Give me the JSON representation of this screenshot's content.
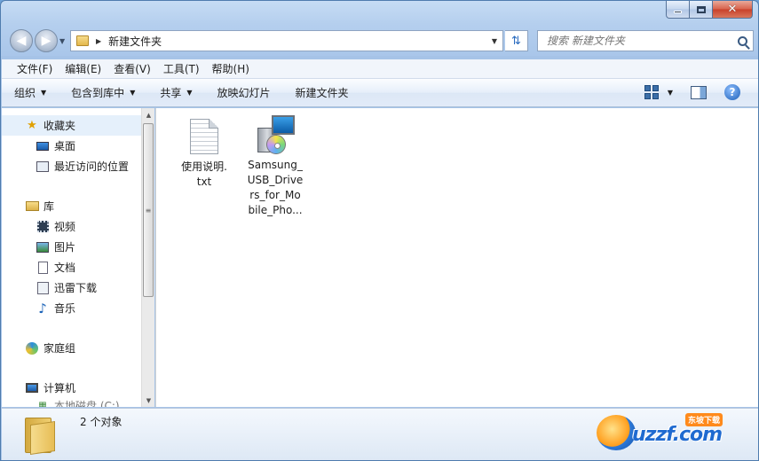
{
  "window": {
    "caption_close": "✕"
  },
  "address": {
    "path": "新建文件夹"
  },
  "search": {
    "placeholder": "搜索 新建文件夹"
  },
  "menubar": {
    "items": [
      "文件(F)",
      "编辑(E)",
      "查看(V)",
      "工具(T)",
      "帮助(H)"
    ]
  },
  "toolbar": {
    "organize": "组织",
    "include_in_library": "包含到库中",
    "share": "共享",
    "slideshow": "放映幻灯片",
    "new_folder": "新建文件夹",
    "help": "?"
  },
  "navpane": {
    "favorites": "收藏夹",
    "desktop": "桌面",
    "recent": "最近访问的位置",
    "libraries": "库",
    "videos": "视频",
    "pictures": "图片",
    "documents": "文档",
    "thunder": "迅雷下载",
    "music": "音乐",
    "homegroup": "家庭组",
    "computer": "计算机",
    "local_disk": "本地磁盘 (C:)"
  },
  "files": [
    {
      "name": "使用说明.txt",
      "line1": "使用说明.",
      "line2": "txt",
      "icon": "text-file-icon"
    },
    {
      "name": "Samsung_USB_Drivers_for_Mobile_Pho...",
      "line1": "Samsung_",
      "line2": "USB_Drive",
      "line3": "rs_for_Mo",
      "line4": "bile_Pho...",
      "icon": "installer-icon"
    }
  ],
  "details": {
    "count": "2 个对象"
  },
  "watermark": {
    "tag": "东坡下载",
    "text": "uzzf.com"
  }
}
